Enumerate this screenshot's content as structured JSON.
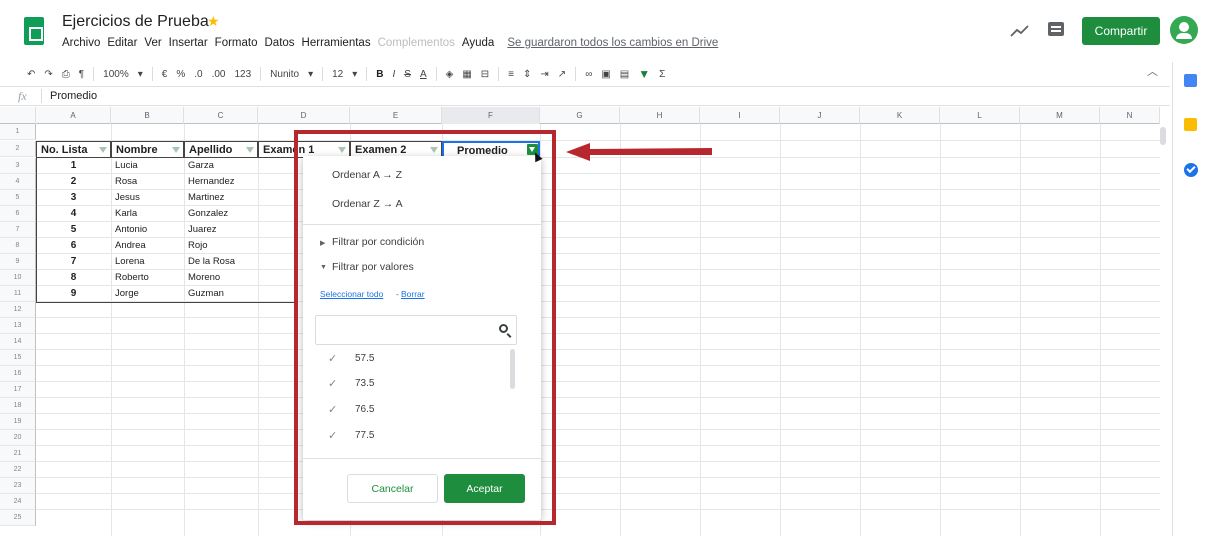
{
  "header": {
    "title": "Ejercicios de Prueba",
    "menu": [
      "Archivo",
      "Editar",
      "Ver",
      "Insertar",
      "Formato",
      "Datos",
      "Herramientas"
    ],
    "menu_disabled": "Complementos",
    "menu_help": "Ayuda",
    "saved_status": "Se guardaron todos los cambios en Drive",
    "share_label": "Compartir"
  },
  "toolbar": {
    "zoom": "100%",
    "currency": "€",
    "percent": "%",
    "dec_less": ".0",
    "dec_more": ".00",
    "format_more": "123",
    "font": "Nunito",
    "font_size": "12",
    "bold": "B",
    "italic": "I",
    "strike": "S",
    "underline_a": "A",
    "link": "∞",
    "sigma": "Σ"
  },
  "formula_bar": {
    "fx": "fx",
    "value": "Promedio"
  },
  "columns": [
    "A",
    "B",
    "C",
    "D",
    "E",
    "F",
    "G",
    "H",
    "I",
    "J",
    "K",
    "L",
    "M",
    "N"
  ],
  "rows": [
    "1",
    "2",
    "3",
    "4",
    "5",
    "6",
    "7",
    "8",
    "9",
    "10",
    "11",
    "12",
    "13",
    "14",
    "15",
    "16",
    "17",
    "18",
    "19",
    "20",
    "21",
    "22",
    "23",
    "24",
    "25"
  ],
  "table": {
    "headers": [
      "No. Lista",
      "Nombre",
      "Apellido",
      "Examen 1",
      "Examen 2",
      "Promedio"
    ],
    "records": [
      {
        "n": "1",
        "nombre": "Lucia",
        "apellido": "Garza"
      },
      {
        "n": "2",
        "nombre": "Rosa",
        "apellido": "Hernandez"
      },
      {
        "n": "3",
        "nombre": "Jesus",
        "apellido": "Martinez"
      },
      {
        "n": "4",
        "nombre": "Karla",
        "apellido": "Gonzalez"
      },
      {
        "n": "5",
        "nombre": "Antonio",
        "apellido": "Juarez"
      },
      {
        "n": "6",
        "nombre": "Andrea",
        "apellido": "Rojo"
      },
      {
        "n": "7",
        "nombre": "Lorena",
        "apellido": "De la Rosa"
      },
      {
        "n": "8",
        "nombre": "Roberto",
        "apellido": "Moreno"
      },
      {
        "n": "9",
        "nombre": "Jorge",
        "apellido": "Guzman"
      }
    ]
  },
  "filter_menu": {
    "sort_az": "Ordenar A → Z",
    "sort_za": "Ordenar Z → A",
    "by_condition": "Filtrar por condición",
    "by_values": "Filtrar por valores",
    "select_all": "Seleccionar todo",
    "link_sep": "-",
    "clear": "Borrar",
    "values": [
      "57.5",
      "73.5",
      "76.5",
      "77.5"
    ],
    "cancel_label": "Cancelar",
    "ok_label": "Aceptar"
  },
  "colors": {
    "accent": "#1e8e3e",
    "annotation": "#b7282e"
  }
}
